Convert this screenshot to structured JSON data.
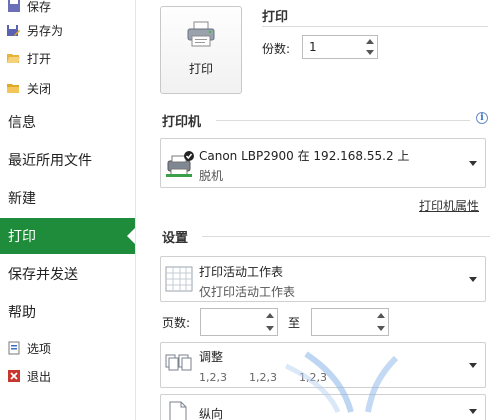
{
  "nav": {
    "save": "保存",
    "save_as": "另存为",
    "open": "打开",
    "close": "关闭",
    "info": "信息",
    "recent": "最近所用文件",
    "new": "新建",
    "print": "打印",
    "save_send": "保存并发送",
    "help": "帮助",
    "options": "选项",
    "exit": "退出"
  },
  "print_section": {
    "title": "打印",
    "button_label": "打印",
    "copies_label": "份数:",
    "copies_value": "1"
  },
  "printer_section": {
    "title": "打印机",
    "info_icon": "i",
    "printer_name": "Canon LBP2900 在 192.168.55.2 上",
    "printer_status": "脱机",
    "properties_link": "打印机属性"
  },
  "settings_section": {
    "title": "设置",
    "scope_main": "打印活动工作表",
    "scope_sub": "仅打印活动工作表",
    "pages_label": "页数:",
    "to_label": "至",
    "pages_from": "",
    "pages_to": "",
    "collate_main": "调整",
    "collate_sub": [
      "1,2,3",
      "1,2,3",
      "1,2,3"
    ],
    "orientation_main": "纵向"
  },
  "colors": {
    "accent": "#1e8c3a"
  }
}
